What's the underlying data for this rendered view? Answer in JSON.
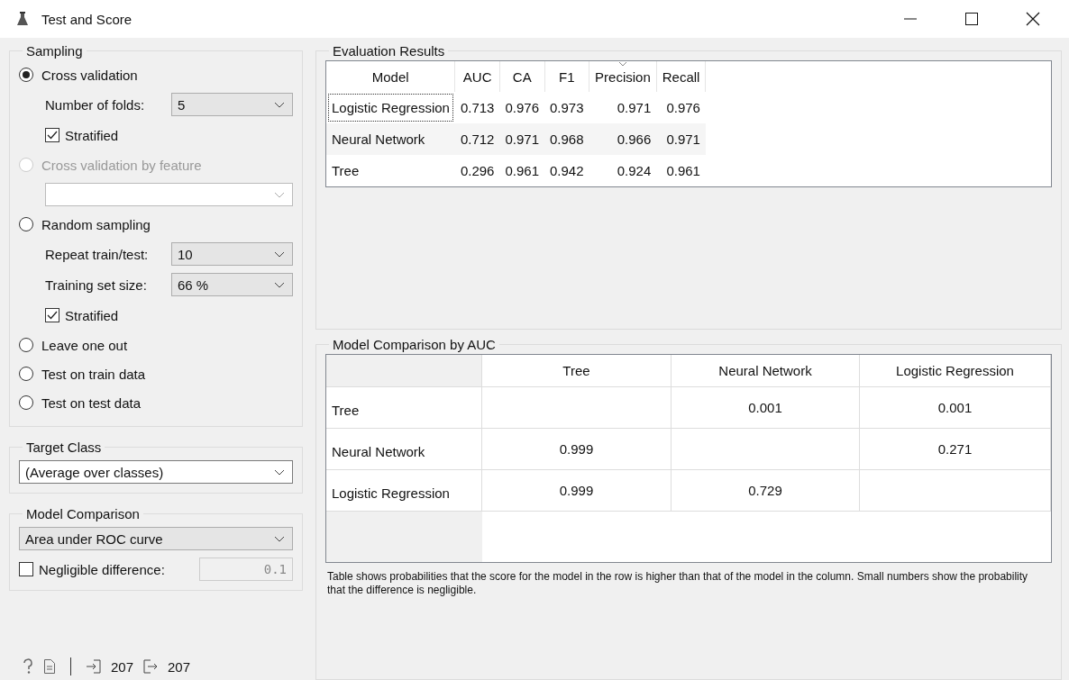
{
  "window": {
    "title": "Test and Score"
  },
  "sampling": {
    "title": "Sampling",
    "options": [
      {
        "label": "Cross validation",
        "selected": true,
        "disabled": false,
        "settings": [
          {
            "kind": "combo",
            "label": "Number of folds:",
            "value": "5"
          },
          {
            "kind": "checkbox",
            "label": "Stratified",
            "checked": true
          }
        ]
      },
      {
        "label": "Cross validation by feature",
        "selected": false,
        "disabled": true,
        "settings": [
          {
            "kind": "combo"
          }
        ]
      },
      {
        "label": "Random sampling",
        "selected": false,
        "disabled": false,
        "settings": [
          {
            "kind": "combo",
            "label": "Repeat train/test:",
            "value": "10"
          },
          {
            "kind": "combo",
            "label": "Training set size:",
            "value": "66 %"
          },
          {
            "kind": "checkbox",
            "label": "Stratified",
            "checked": true
          }
        ]
      },
      {
        "label": "Leave one out",
        "selected": false,
        "disabled": false
      },
      {
        "label": "Test on train data",
        "selected": false,
        "disabled": false
      },
      {
        "label": "Test on test data",
        "selected": false,
        "disabled": false
      }
    ]
  },
  "target_class": {
    "title": "Target Class",
    "value": "(Average over classes)"
  },
  "model_comparison": {
    "title": "Model Comparison",
    "value": "Area under ROC curve",
    "negligible": {
      "label": "Negligible difference:",
      "checked": false,
      "value": "0.1"
    }
  },
  "status_bar": {
    "input_count": "207",
    "output_count": "207"
  },
  "evaluation_results": {
    "title": "Evaluation Results",
    "columns": [
      {
        "label": "Model",
        "sorted": false
      },
      {
        "label": "AUC",
        "sorted": false
      },
      {
        "label": "CA",
        "sorted": false
      },
      {
        "label": "F1",
        "sorted": false
      },
      {
        "label": "Precision",
        "sorted": true
      },
      {
        "label": "Recall",
        "sorted": false
      }
    ],
    "rows": [
      {
        "focused": true,
        "cells": [
          "Logistic Regression",
          "0.713",
          "0.976",
          "0.973",
          "0.971",
          "0.976"
        ]
      },
      {
        "focused": false,
        "cells": [
          "Neural Network",
          "0.712",
          "0.971",
          "0.968",
          "0.966",
          "0.971"
        ]
      },
      {
        "focused": false,
        "cells": [
          "Tree",
          "0.296",
          "0.961",
          "0.942",
          "0.924",
          "0.961"
        ]
      }
    ]
  },
  "comparison": {
    "title": "Model Comparison by AUC",
    "columns": [
      "Tree",
      "Neural Network",
      "Logistic Regression"
    ],
    "rows": [
      {
        "label": "Tree",
        "cells": [
          null,
          "0.001",
          "0.001"
        ]
      },
      {
        "label": "Neural Network",
        "cells": [
          "0.999",
          null,
          "0.271"
        ]
      },
      {
        "label": "Logistic Regression",
        "cells": [
          "0.999",
          "0.729",
          null
        ]
      }
    ],
    "note": "Table shows probabilities that the score for the model in the row is higher than that of the model in the column. Small numbers show the probability that the difference is negligible."
  }
}
